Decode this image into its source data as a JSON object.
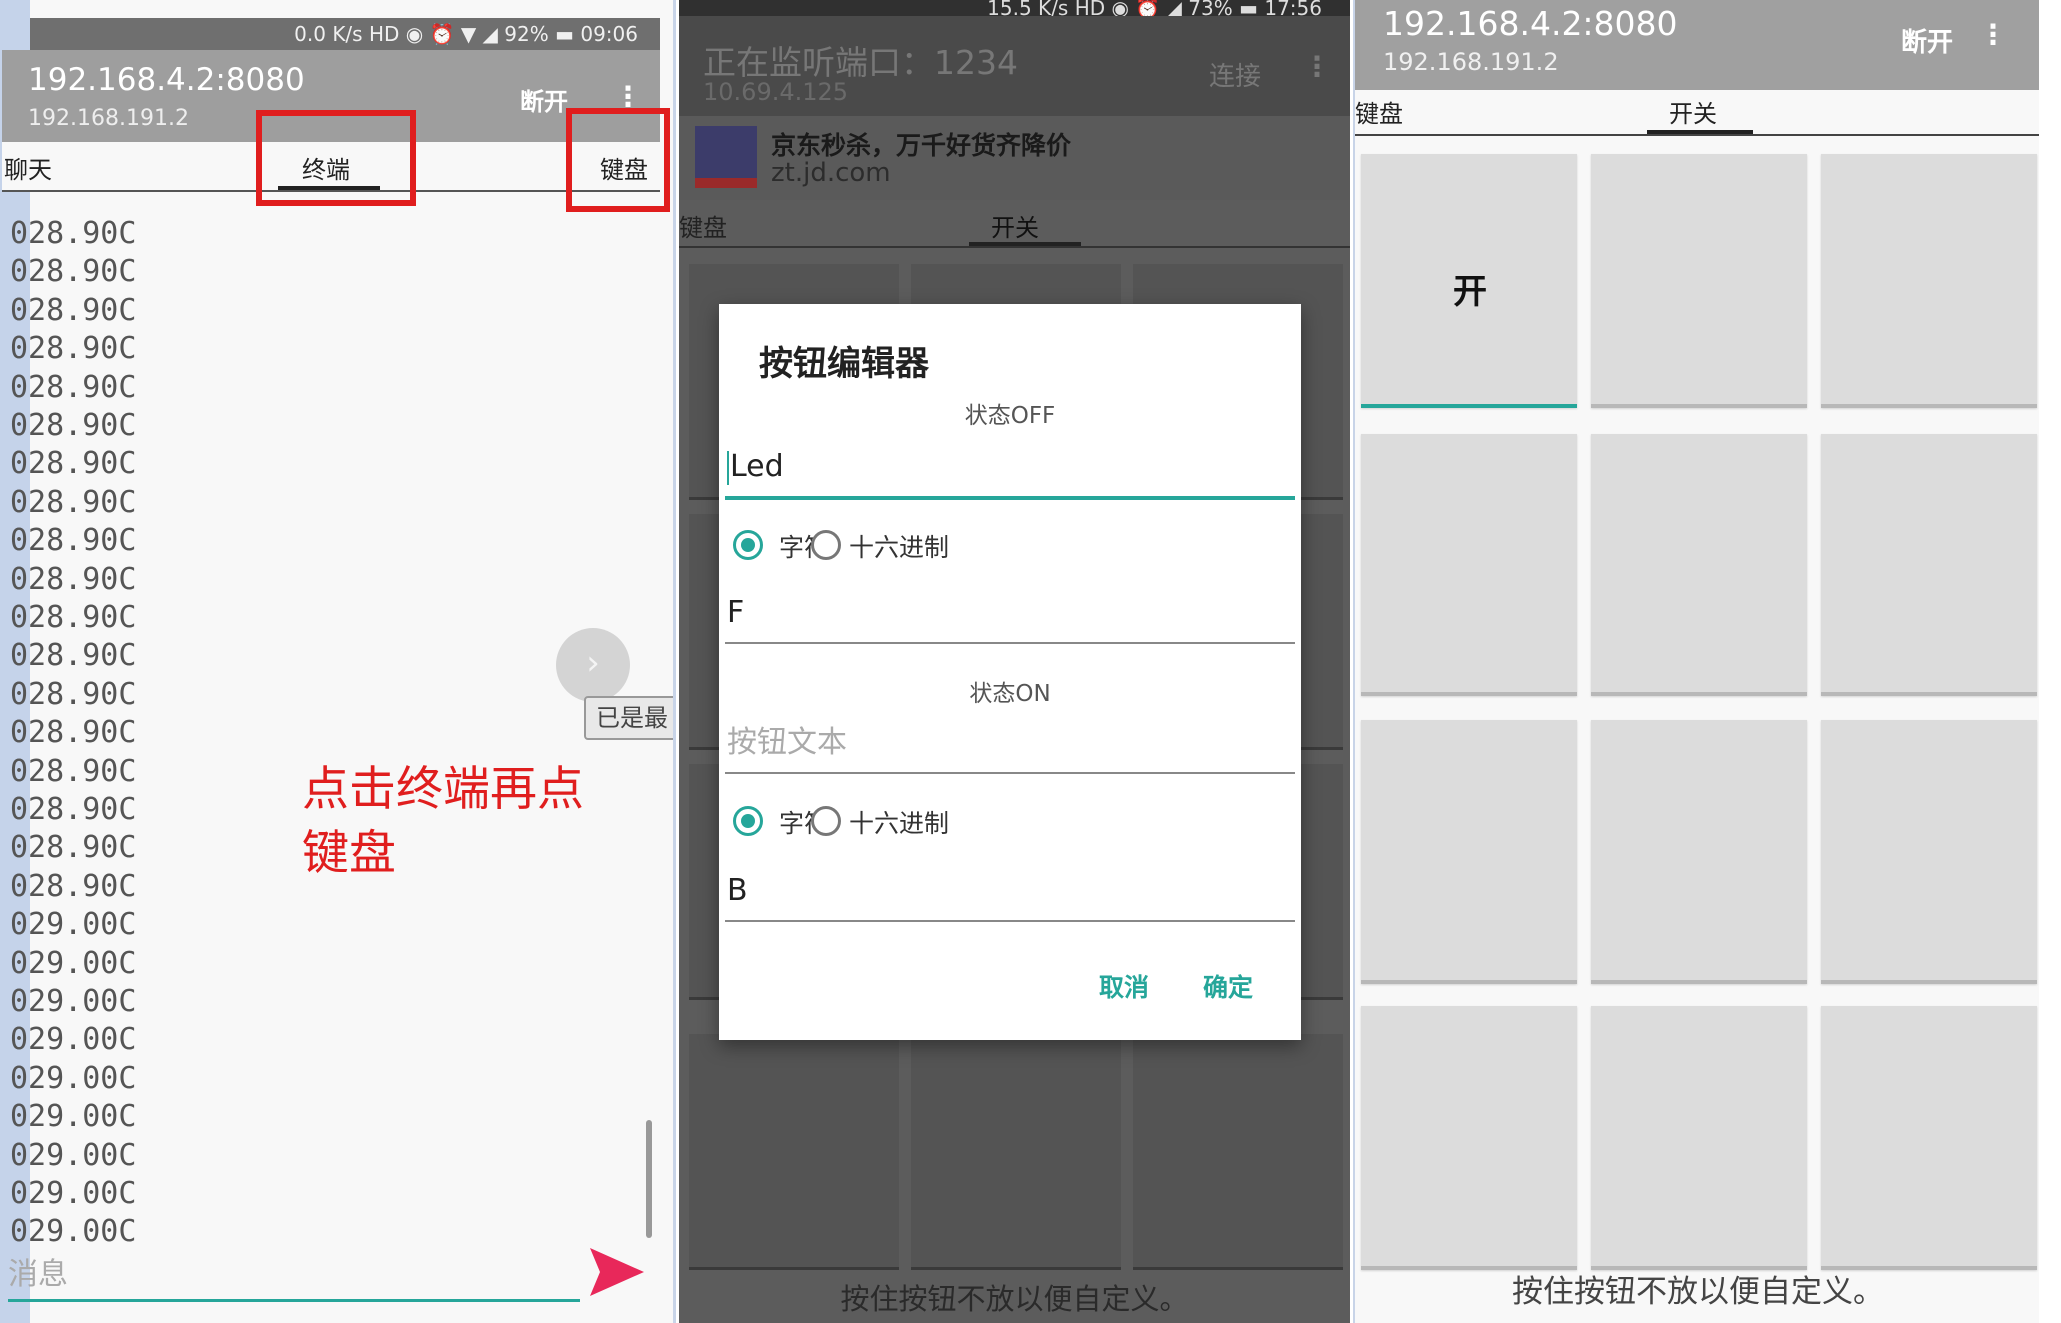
{
  "screen1": {
    "status": "0.0 K/s  HD  ◉  ⏰  ▼  ◢  92%  ▬  09:06",
    "title": "192.168.4.2:8080",
    "subtitle": "192.168.191.2",
    "disconnect": "断开",
    "tabs": [
      "聊天",
      "终端",
      "键盘"
    ],
    "terminal_lines": [
      "028.90C",
      "028.90C",
      "028.90C",
      "028.90C",
      "028.90C",
      "028.90C",
      "028.90C",
      "028.90C",
      "028.90C",
      "028.90C",
      "028.90C",
      "028.90C",
      "028.90C",
      "028.90C",
      "028.90C",
      "028.90C",
      "028.90C",
      "028.90C",
      "029.00C",
      "029.00C",
      "029.00C",
      "029.00C",
      "029.00C",
      "029.00C",
      "029.00C",
      "029.00C",
      "029.00C"
    ],
    "toast": "已是最",
    "annotation_line1": "点击终端再点",
    "annotation_line2": "键盘",
    "message_placeholder": "消息"
  },
  "screen2": {
    "status": "15.5 K/s  HD  ◉  ⏰  ◢  73%  ▬  17:56",
    "title": "正在监听端口：1234",
    "subtitle": "10.69.4.125",
    "connect": "连接",
    "ad_title": "京东秒杀，万千好货齐降价",
    "ad_url": "zt.jd.com",
    "tabs": [
      "键盘",
      "开关"
    ],
    "hint": "按住按钮不放以便自定义。",
    "dialog": {
      "title": "按钮编辑器",
      "off_label": "状态OFF",
      "off_text": "Led",
      "radio_char": "字符",
      "radio_hex": "十六进制",
      "off_value": "F",
      "on_label": "状态ON",
      "on_placeholder": "按钮文本",
      "on_value": "B",
      "cancel": "取消",
      "ok": "确定"
    }
  },
  "screen3": {
    "title": "192.168.4.2:8080",
    "subtitle": "192.168.191.2",
    "disconnect": "断开",
    "tabs": [
      "键盘",
      "开关"
    ],
    "first_button_label": "开",
    "hint": "按住按钮不放以便自定义。"
  },
  "colors": {
    "accent": "#26a69a",
    "annotation_red": "#e01e1e",
    "appbar_gray": "#9e9e9e"
  }
}
